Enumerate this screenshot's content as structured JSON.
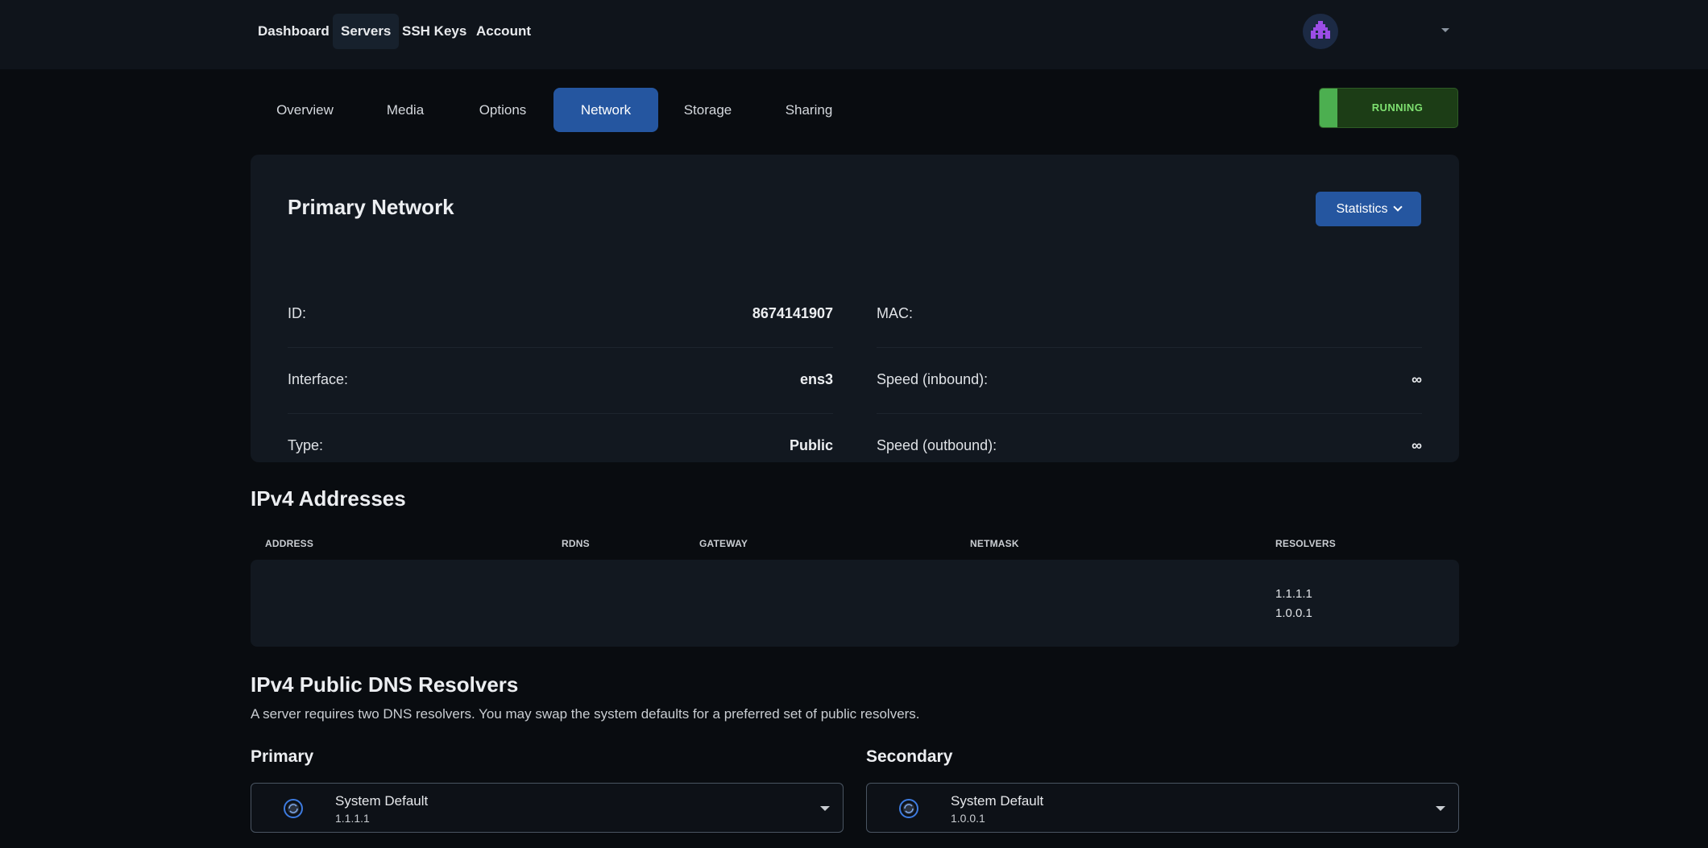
{
  "nav": {
    "items": [
      {
        "label": "Dashboard",
        "active": false
      },
      {
        "label": "Servers",
        "active": true
      },
      {
        "label": "SSH Keys",
        "active": false
      },
      {
        "label": "Account",
        "active": false
      }
    ]
  },
  "tabs": [
    {
      "label": "Overview",
      "active": false
    },
    {
      "label": "Media",
      "active": false
    },
    {
      "label": "Options",
      "active": false
    },
    {
      "label": "Network",
      "active": true
    },
    {
      "label": "Storage",
      "active": false
    },
    {
      "label": "Sharing",
      "active": false
    }
  ],
  "status": {
    "label": "RUNNING",
    "color": "#4caf50"
  },
  "network": {
    "title": "Primary Network",
    "statistics_label": "Statistics",
    "left": [
      {
        "key": "ID:",
        "value": "8674141907"
      },
      {
        "key": "Interface:",
        "value": "ens3"
      },
      {
        "key": "Type:",
        "value": "Public"
      }
    ],
    "right": [
      {
        "key": "MAC:",
        "value": ""
      },
      {
        "key": "Speed (inbound):",
        "value": "∞"
      },
      {
        "key": "Speed (outbound):",
        "value": "∞"
      }
    ]
  },
  "ipv4": {
    "title": "IPv4 Addresses",
    "columns": [
      "ADDRESS",
      "RDNS",
      "GATEWAY",
      "NETMASK",
      "RESOLVERS"
    ],
    "rows": [
      {
        "address": "",
        "rdns": "",
        "gateway": "",
        "netmask": "",
        "resolvers": [
          "1.1.1.1",
          "1.0.0.1"
        ]
      }
    ]
  },
  "dns": {
    "title": "IPv4 Public DNS Resolvers",
    "description": "A server requires two DNS resolvers. You may swap the system defaults for a preferred set of public resolvers.",
    "primary": {
      "label": "Primary",
      "name": "System Default",
      "ip": "1.1.1.1"
    },
    "secondary": {
      "label": "Secondary",
      "name": "System Default",
      "ip": "1.0.0.1"
    }
  },
  "colors": {
    "accent": "#2556a0",
    "background": "#090c10",
    "card": "#121820"
  }
}
